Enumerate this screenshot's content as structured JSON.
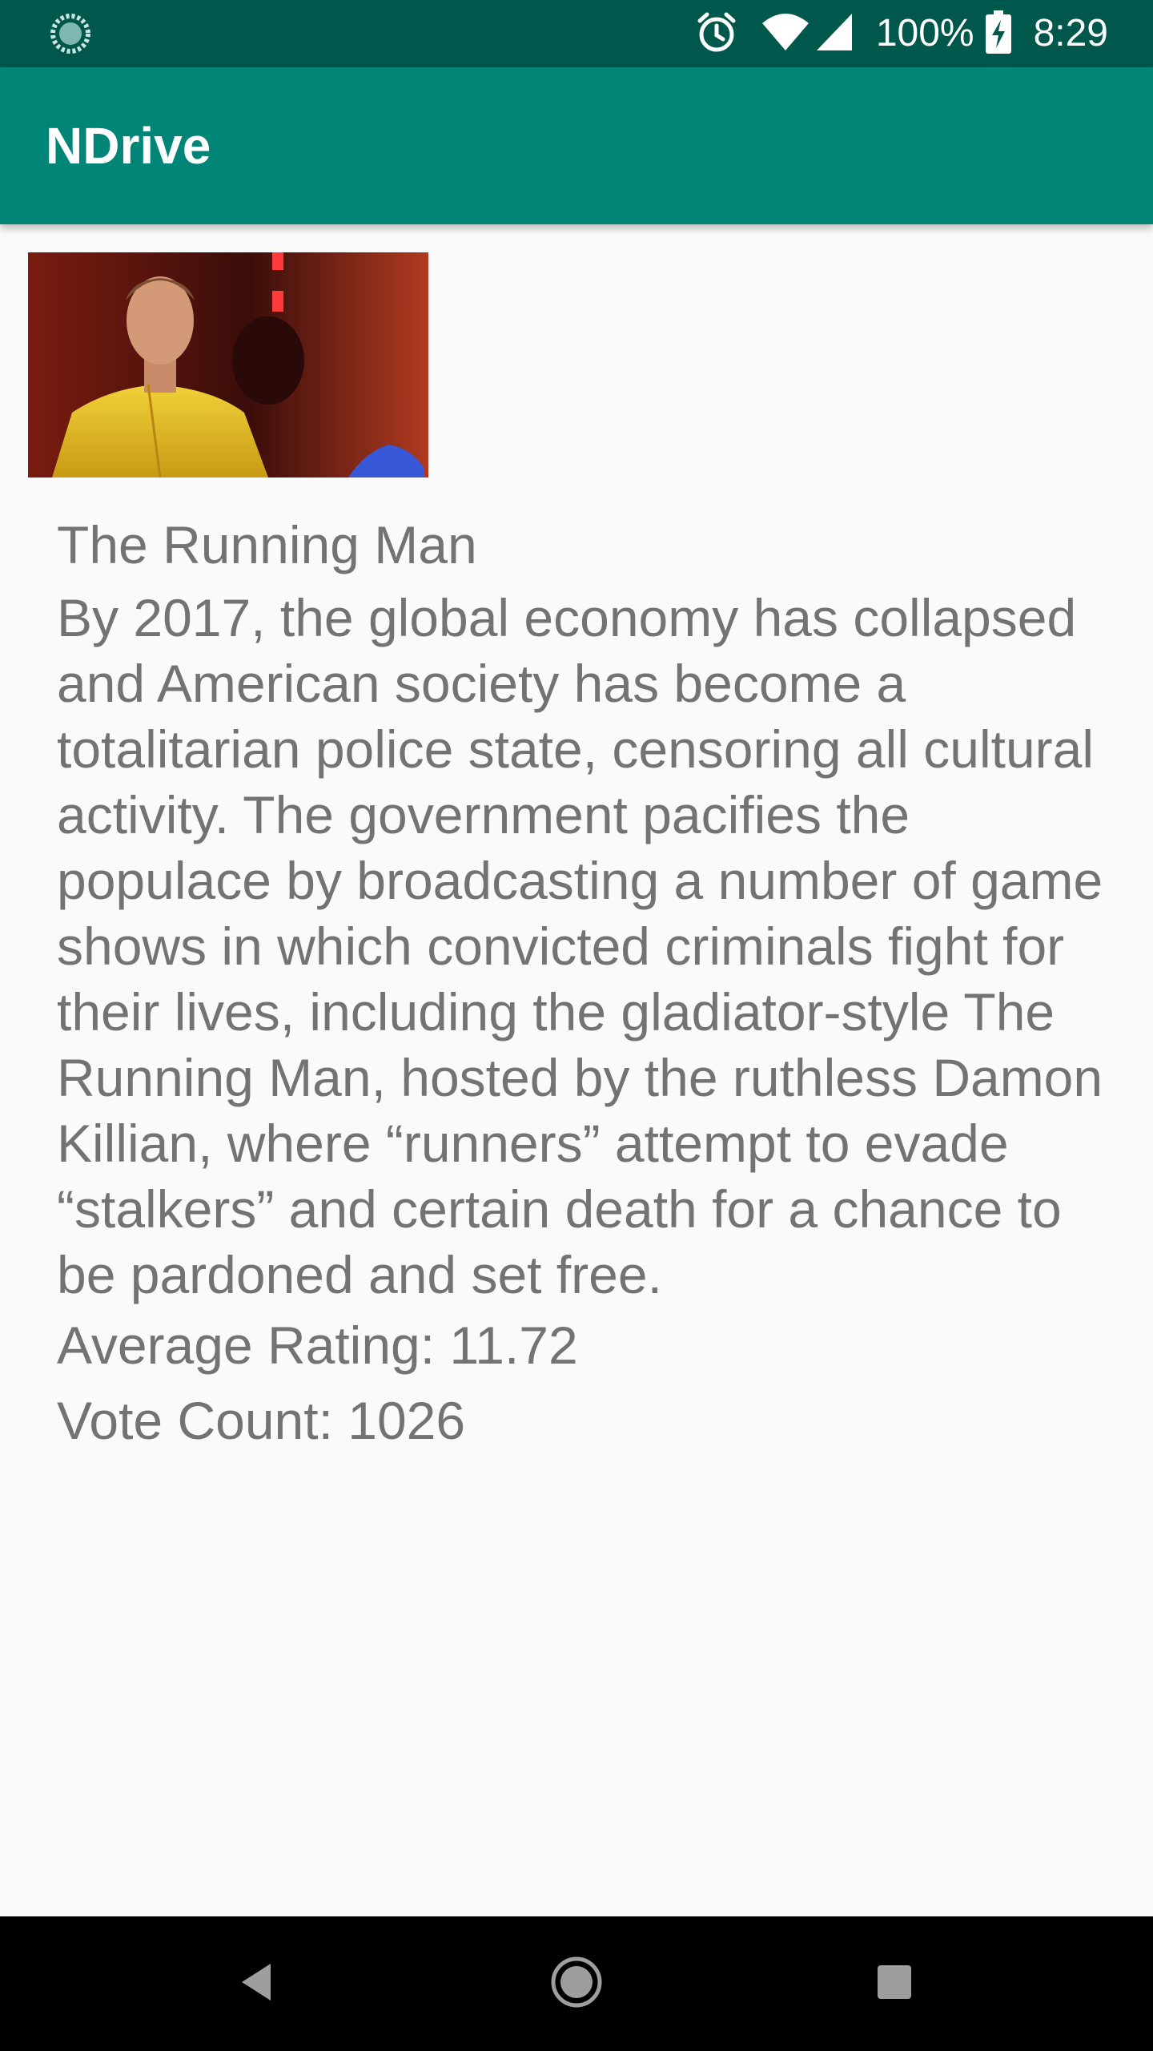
{
  "status_bar": {
    "battery": "100%",
    "time": "8:29",
    "icons": [
      "sync-icon",
      "alarm-icon",
      "wifi-icon",
      "signal-icon",
      "battery-charging-icon"
    ]
  },
  "app_bar": {
    "title": "NDrive"
  },
  "movie": {
    "poster_icon": "movie-poster-image",
    "title": "The Running Man",
    "overview": "By 2017, the global economy has collapsed and American society has become a totalitarian police state, censoring all cultural activity. The government pacifies the populace by broadcasting a number of game shows in which convicted criminals fight for their lives, including the gladiator-style The Running Man, hosted by the ruthless Damon Killian, where “runners” attempt to evade “stalkers” and certain death for a chance to be pardoned and set free.",
    "rating": "Average Rating: 11.72",
    "votes": "Vote Count: 1026"
  },
  "nav_bar": {
    "icons": [
      "back-icon",
      "home-icon",
      "recents-icon"
    ]
  },
  "colors": {
    "status_bar": "#00574b",
    "app_bar": "#008577",
    "background": "#fafafa",
    "text": "#737373"
  }
}
